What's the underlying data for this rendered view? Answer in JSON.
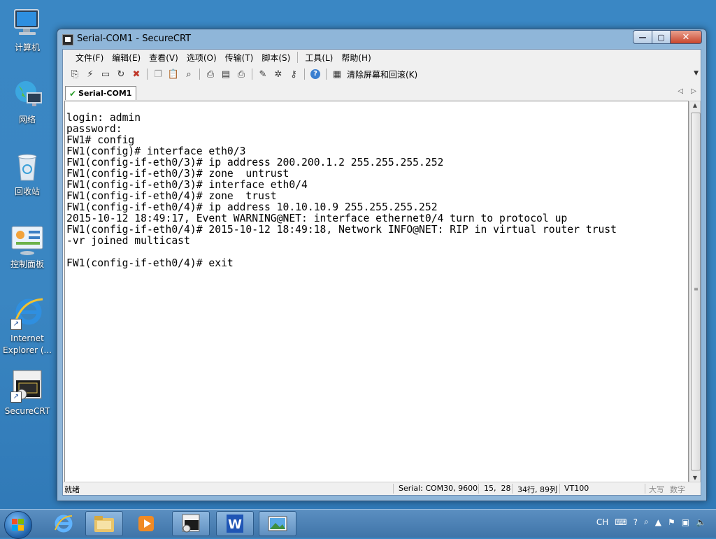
{
  "desktop": {
    "icons": [
      {
        "label": "计算机"
      },
      {
        "label": "网络"
      },
      {
        "label": "回收站"
      },
      {
        "label": "控制面板"
      },
      {
        "label": "Internet Explorer (..."
      },
      {
        "label": "SecureCRT"
      }
    ]
  },
  "window": {
    "title": "Serial-COM1 - SecureCRT",
    "controls": {
      "minimize": "—",
      "maximize": "▢",
      "close": "✕"
    }
  },
  "menubar": {
    "items": [
      {
        "label": "文件(F)"
      },
      {
        "label": "编辑(E)"
      },
      {
        "label": "查看(V)"
      },
      {
        "label": "选项(O)"
      },
      {
        "label": "传输(T)"
      },
      {
        "label": "脚本(S)"
      },
      {
        "label": "工具(L)"
      },
      {
        "label": "帮助(H)"
      }
    ]
  },
  "toolbar": {
    "clear_label": "清除屏幕和回滚(K)",
    "icons": [
      "connect-icon",
      "quick-connect-icon",
      "connect-tab-icon",
      "reconnect-icon",
      "disconnect-icon",
      "copy-icon",
      "paste-icon",
      "find-icon",
      "print-icon",
      "print-setup-icon",
      "print-selection-icon",
      "session-options-icon",
      "global-options-icon",
      "keymap-icon",
      "help-icon",
      "clear-screen-icon"
    ]
  },
  "tabs": [
    {
      "label": "Serial-COM1",
      "active": true
    }
  ],
  "terminal": {
    "lines": [
      "login: admin",
      "password:",
      "FW1# config",
      "FW1(config)# interface eth0/3",
      "FW1(config-if-eth0/3)# ip address 200.200.1.2 255.255.255.252",
      "FW1(config-if-eth0/3)# zone  untrust",
      "FW1(config-if-eth0/3)# interface eth0/4",
      "FW1(config-if-eth0/4)# zone  trust",
      "FW1(config-if-eth0/4)# ip address 10.10.10.9 255.255.255.252",
      "2015-10-12 18:49:17, Event WARNING@NET: interface ethernet0/4 turn to protocol up",
      "FW1(config-if-eth0/4)# 2015-10-12 18:49:18, Network INFO@NET: RIP in virtual router trust",
      "-vr joined multicast",
      "",
      "FW1(config-if-eth0/4)# exit"
    ]
  },
  "statusbar": {
    "status": "就绪",
    "serial": "Serial: COM30, 9600",
    "cursor": "15,  28",
    "size": "34行, 89列",
    "emulation": "VT100",
    "caps": "大写",
    "num": "数字"
  },
  "taskbar": {
    "tray_lang": "CH"
  }
}
